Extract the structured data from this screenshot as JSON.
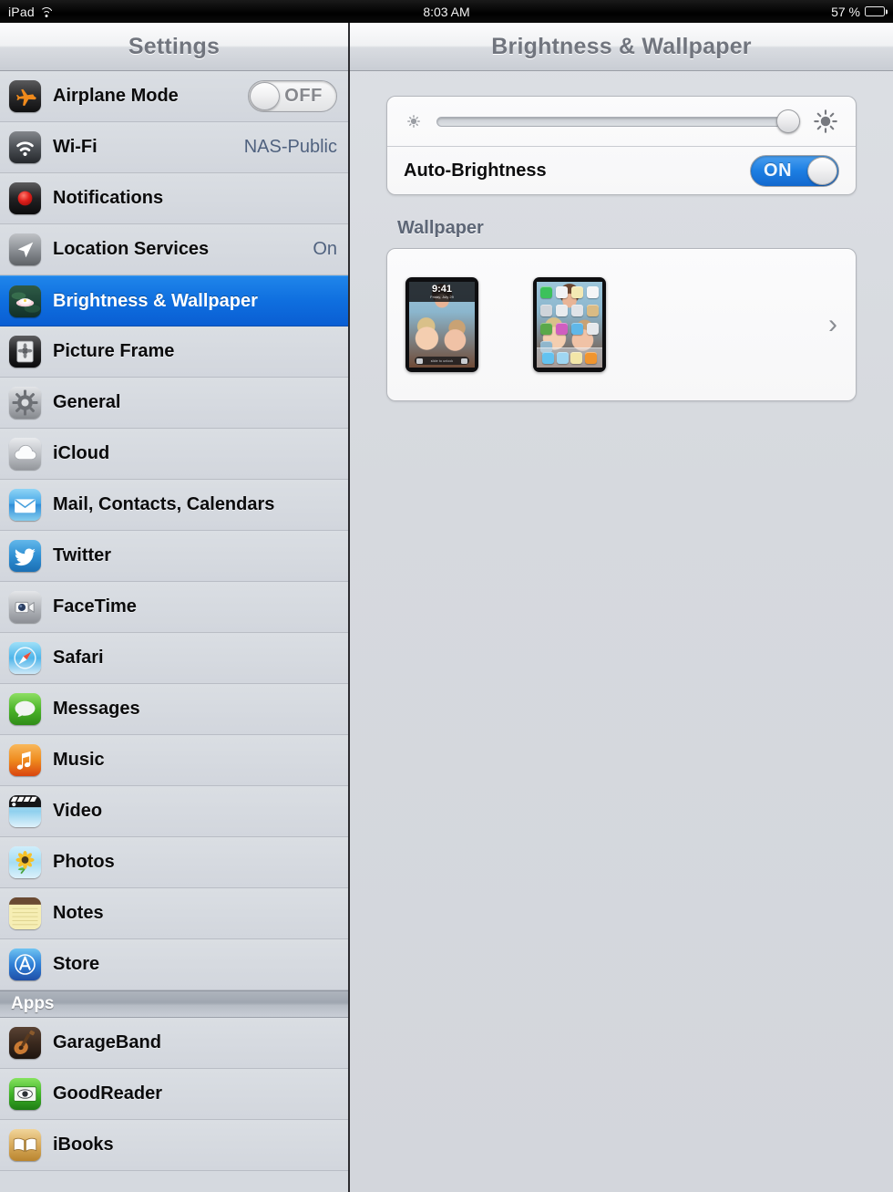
{
  "statusbar": {
    "device": "iPad",
    "wifi_icon": "wifi-icon",
    "time": "8:03 AM",
    "battery_percent": "57 %",
    "battery_level": 57
  },
  "sidebar": {
    "title": "Settings",
    "groups": [
      {
        "header": null,
        "items": [
          {
            "label": "Airplane Mode",
            "icon": "airplane-icon",
            "control": "toggle",
            "toggle_state": "OFF",
            "value": null
          },
          {
            "label": "Wi-Fi",
            "icon": "wifi-settings-icon",
            "control": "value",
            "value": "NAS-Public"
          },
          {
            "label": "Notifications",
            "icon": "notifications-icon",
            "control": "none",
            "value": null
          },
          {
            "label": "Location Services",
            "icon": "location-services-icon",
            "control": "value",
            "value": "On"
          },
          {
            "label": "Brightness & Wallpaper",
            "icon": "brightness-wallpaper-icon",
            "control": "none",
            "value": null,
            "selected": true
          },
          {
            "label": "Picture Frame",
            "icon": "picture-frame-icon",
            "control": "none",
            "value": null
          },
          {
            "label": "General",
            "icon": "general-gear-icon",
            "control": "none",
            "value": null
          },
          {
            "label": "iCloud",
            "icon": "icloud-icon",
            "control": "none",
            "value": null
          },
          {
            "label": "Mail, Contacts, Calendars",
            "icon": "mail-icon",
            "control": "none",
            "value": null
          },
          {
            "label": "Twitter",
            "icon": "twitter-icon",
            "control": "none",
            "value": null
          },
          {
            "label": "FaceTime",
            "icon": "facetime-icon",
            "control": "none",
            "value": null
          },
          {
            "label": "Safari",
            "icon": "safari-compass-icon",
            "control": "none",
            "value": null
          },
          {
            "label": "Messages",
            "icon": "messages-bubble-icon",
            "control": "none",
            "value": null
          },
          {
            "label": "Music",
            "icon": "music-note-icon",
            "control": "none",
            "value": null
          },
          {
            "label": "Video",
            "icon": "video-clapper-icon",
            "control": "none",
            "value": null
          },
          {
            "label": "Photos",
            "icon": "photos-sunflower-icon",
            "control": "none",
            "value": null
          },
          {
            "label": "Notes",
            "icon": "notes-icon",
            "control": "none",
            "value": null
          },
          {
            "label": "Store",
            "icon": "app-store-icon",
            "control": "none",
            "value": null
          }
        ]
      },
      {
        "header": "Apps",
        "items": [
          {
            "label": "GarageBand",
            "icon": "garageband-guitar-icon",
            "control": "none",
            "value": null
          },
          {
            "label": "GoodReader",
            "icon": "goodreader-eye-icon",
            "control": "none",
            "value": null
          },
          {
            "label": "iBooks",
            "icon": "ibooks-book-icon",
            "control": "none",
            "value": null
          }
        ]
      }
    ]
  },
  "detail": {
    "title": "Brightness & Wallpaper",
    "brightness": {
      "low_icon": "sun-low-icon",
      "high_icon": "sun-high-icon",
      "value_percent": 97
    },
    "auto_brightness": {
      "label": "Auto-Brightness",
      "toggle_state": "ON"
    },
    "wallpaper": {
      "section_title": "Wallpaper",
      "lock_screen_time": "9:41",
      "lock_screen_date": "Friday, July 29",
      "lock_screen_slide_label": "slide to unlock",
      "chevron_icon": "chevron-right-icon"
    }
  },
  "colors": {
    "accent_blue": "#1d7fe3",
    "selected_row": "#0f6fdf",
    "sidebar_bg": "#d5d9df",
    "detail_bg": "#d6d9de",
    "value_text": "#50627f"
  }
}
